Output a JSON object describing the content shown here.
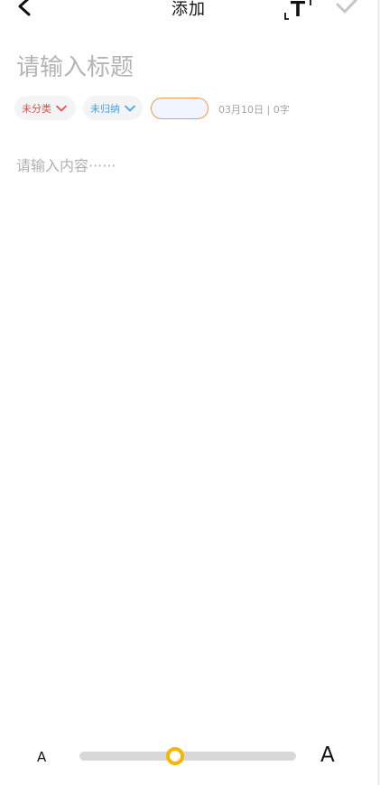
{
  "header": {
    "title": "添加",
    "icons": {
      "back": "chevron-left-icon",
      "format": "text-format-icon",
      "confirm": "checkmark-icon"
    }
  },
  "note": {
    "title_placeholder": "请输入标题",
    "content_placeholder": "请输入内容······"
  },
  "meta": {
    "category_label": "未分类",
    "archive_label": "未归纳",
    "date_and_count": "03月10日 | 0字"
  },
  "font_slider": {
    "small_label": "A",
    "large_label": "A",
    "level": 0.44
  },
  "colors": {
    "category": "#ee4a3c",
    "archive": "#3fa2ea",
    "tag_border": "#f29a4f",
    "slider_thumb": "#f7b500",
    "placeholder": "#b4b4b4"
  }
}
